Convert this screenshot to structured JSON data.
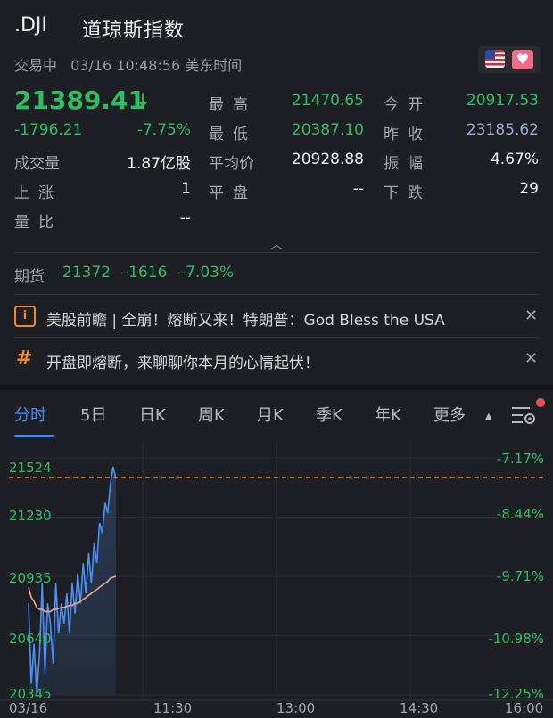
{
  "header": {
    "symbol": ".DJI",
    "name": "道琼斯指数",
    "status": "交易中",
    "datetime": "03/16 10:48:56 美东时间",
    "flag_icon": "us-flag-icon",
    "favorite_icon": "heart-icon"
  },
  "quote": {
    "price": "21389.41",
    "change": "-1796.21",
    "change_pct": "-7.75%",
    "volume_label": "成交量",
    "volume": "1.87亿股",
    "up_label": "上涨",
    "up": "1",
    "ratio_label": "量比",
    "ratio": "--",
    "high_label": "最高",
    "high": "21470.65",
    "low_label": "最低",
    "low": "20387.10",
    "avg_label": "平均价",
    "avg": "20928.88",
    "flat_label": "平盘",
    "flat": "--",
    "open_label": "今开",
    "open": "20917.53",
    "prev_label": "昨收",
    "prev": "23185.62",
    "amp_label": "振幅",
    "amp": "4.67%",
    "down_label": "下跌",
    "down": "29"
  },
  "futures": {
    "label": "期货",
    "price": "21372",
    "change": "-1616",
    "change_pct": "-7.03%"
  },
  "news": [
    {
      "icon": "info-icon",
      "text": "美股前瞻 | 全崩！熔断又来！特朗普：God Bless the USA"
    },
    {
      "icon": "hashtag-icon",
      "text": "开盘即熔断，来聊聊你本月的心情起伏！"
    }
  ],
  "tabs": [
    "分时",
    "5日",
    "日K",
    "周K",
    "月K",
    "季K",
    "年K",
    "更多"
  ],
  "active_tab": "分时",
  "colors": {
    "up": "#2dbd62",
    "accent": "#3f8cf7",
    "ref_line": "#f08a2a",
    "avg_line": "#f4a58a"
  },
  "chart_data": {
    "type": "line",
    "y_ticks": [
      "21524",
      "21230",
      "20935",
      "20640",
      "20345"
    ],
    "y_pct_ticks": [
      "-7.17%",
      "-8.44%",
      "-9.71%",
      "-10.98%",
      "-12.25%"
    ],
    "x_ticks": [
      "03/16",
      "11:30",
      "13:00",
      "14:30",
      "16:00"
    ],
    "ylim": [
      20345,
      21524
    ],
    "reference_line": 21524,
    "series": [
      {
        "values": [
          20800,
          20400,
          20600,
          20350,
          20550,
          20900,
          20450,
          20800,
          20700,
          20500,
          20900,
          20650,
          20800,
          20700,
          20850,
          20650,
          20900,
          20750,
          20950,
          20800,
          21000,
          20850,
          21050,
          20900,
          21100,
          21000,
          21200,
          21150,
          21300,
          21250,
          21400,
          21480,
          21420
        ]
      },
      {
        "values": [
          20880,
          20830,
          20810,
          20780,
          20770,
          20770,
          20760,
          20760,
          20760,
          20770,
          20770,
          20775,
          20780,
          20780,
          20785,
          20790,
          20790,
          20800,
          20800,
          20810,
          20820,
          20830,
          20840,
          20850,
          20860,
          20870,
          20880,
          20890,
          20900,
          20910,
          20925,
          20930,
          20935
        ]
      }
    ]
  }
}
